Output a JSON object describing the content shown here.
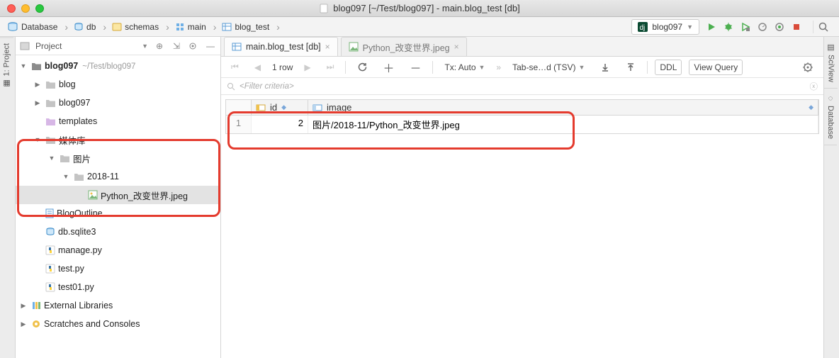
{
  "window_title": "blog097 [~/Test/blog097] - main.blog_test [db]",
  "breadcrumb": [
    "Database",
    "db",
    "schemas",
    "main",
    "blog_test"
  ],
  "run_config": "blog097",
  "left_tabs": [
    "1: Project"
  ],
  "right_tabs": [
    "SciView",
    "Database"
  ],
  "project_panel": {
    "title": "Project",
    "tree": {
      "root_name": "blog097",
      "root_path": "~/Test/blog097",
      "blog": "blog",
      "blog097": "blog097",
      "templates": "templates",
      "media": "媒体库",
      "pic": "图片",
      "date": "2018-11",
      "jpeg": "Python_改变世界.jpeg",
      "blogoutline": "BlogOutline",
      "sqlite": "db.sqlite3",
      "manage": "manage.py",
      "test": "test.py",
      "test01": "test01.py",
      "ext": "External Libraries",
      "scratch": "Scratches and Consoles"
    }
  },
  "editor_tabs": [
    {
      "label": "main.blog_test [db]",
      "active": true
    },
    {
      "label": "Python_改变世界.jpeg",
      "active": false
    }
  ],
  "toolbar": {
    "rows": "1 row",
    "tx": "Tx: Auto",
    "export": "Tab-se…d (TSV)",
    "ddl": "DDL",
    "view_query": "View Query"
  },
  "filter_placeholder": "<Filter criteria>",
  "chart_data": {
    "type": "table",
    "columns": [
      "id",
      "image"
    ],
    "rows": [
      {
        "n": 1,
        "id": 2,
        "image": "图片/2018-11/Python_改变世界.jpeg"
      }
    ]
  }
}
